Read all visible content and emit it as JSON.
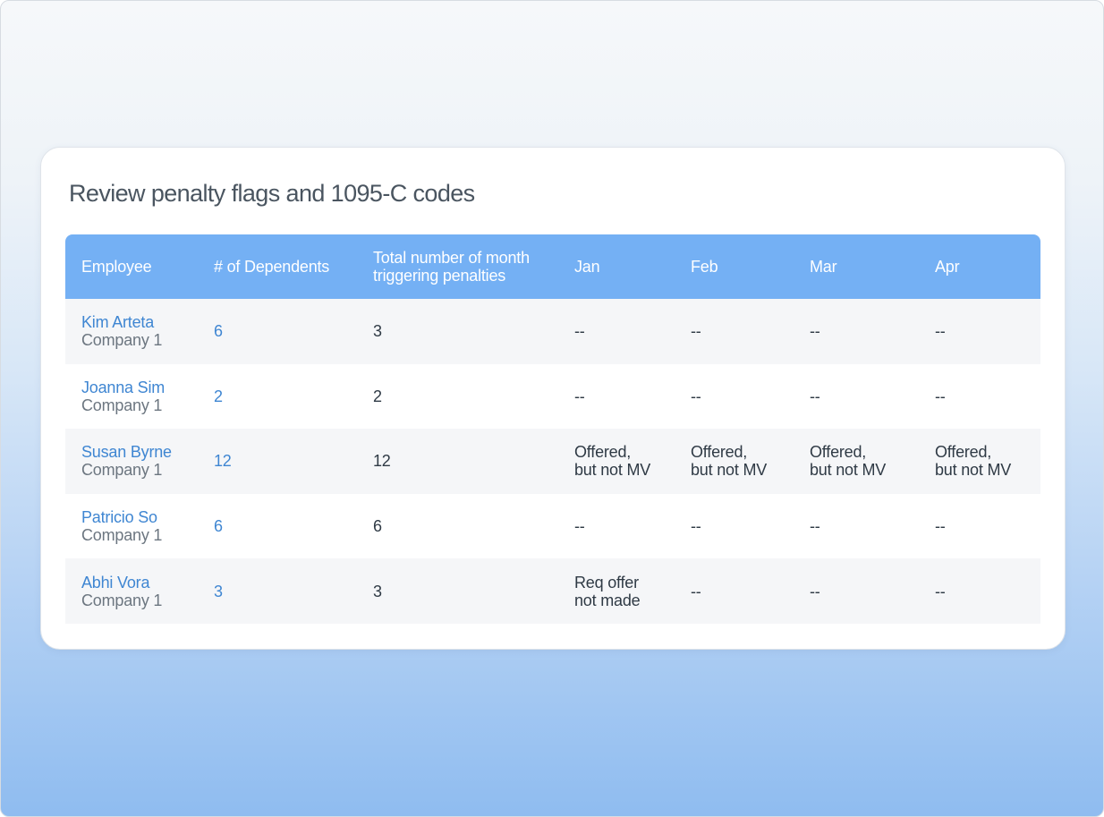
{
  "card": {
    "title": "Review penalty flags and 1095-C codes"
  },
  "table": {
    "headers": {
      "employee": "Employee",
      "dependents": "# of Dependents",
      "total_line1": "Total number of month",
      "total_line2": "triggering penalties",
      "jan": "Jan",
      "feb": "Feb",
      "mar": "Mar",
      "apr": "Apr"
    },
    "rows": [
      {
        "name": "Kim Arteta",
        "company": "Company 1",
        "dependents": "6",
        "total": "3",
        "jan": [
          "--"
        ],
        "feb": [
          "--"
        ],
        "mar": [
          "--"
        ],
        "apr": [
          "--"
        ]
      },
      {
        "name": "Joanna Sim",
        "company": "Company 1",
        "dependents": "2",
        "total": "2",
        "jan": [
          "--"
        ],
        "feb": [
          "--"
        ],
        "mar": [
          "--"
        ],
        "apr": [
          "--"
        ]
      },
      {
        "name": "Susan Byrne",
        "company": "Company 1",
        "dependents": "12",
        "total": "12",
        "jan": [
          "Offered,",
          "but not MV"
        ],
        "feb": [
          "Offered,",
          "but not MV"
        ],
        "mar": [
          "Offered,",
          "but not MV"
        ],
        "apr": [
          "Offered,",
          "but not MV"
        ]
      },
      {
        "name": "Patricio So",
        "company": "Company 1",
        "dependents": "6",
        "total": "6",
        "jan": [
          "--"
        ],
        "feb": [
          "--"
        ],
        "mar": [
          "--"
        ],
        "apr": [
          "--"
        ]
      },
      {
        "name": "Abhi Vora",
        "company": "Company 1",
        "dependents": "3",
        "total": "3",
        "jan": [
          "Req offer",
          "not made"
        ],
        "feb": [
          "--"
        ],
        "mar": [
          "--"
        ],
        "apr": [
          "--"
        ]
      }
    ]
  },
  "colors": {
    "header_bg": "#74b0f4",
    "link": "#3f86d2",
    "row_alt": "#f5f6f8"
  }
}
